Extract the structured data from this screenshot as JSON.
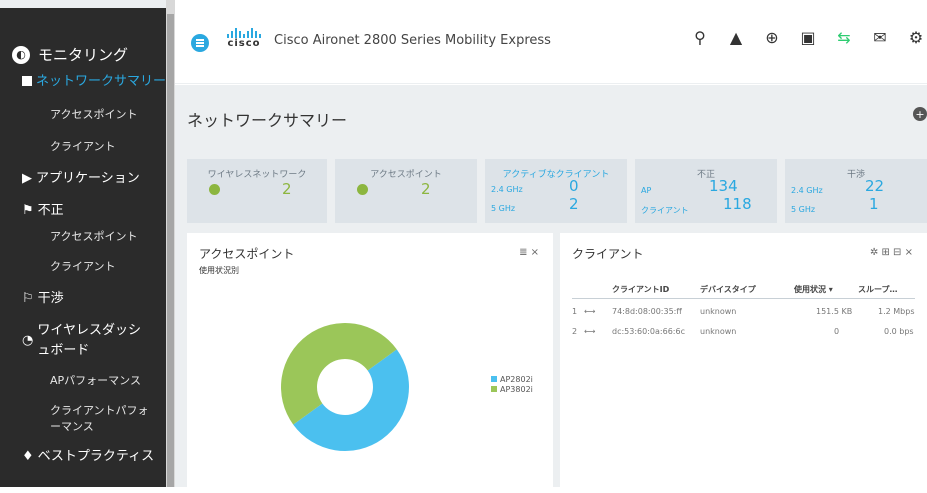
{
  "sidebar": {
    "heading": "モニタリング",
    "active_item": "ネットワークサマリー",
    "items": [
      {
        "type": "sub",
        "label": "アクセスポイント"
      },
      {
        "type": "sub",
        "label": "クライアント"
      },
      {
        "type": "section",
        "icon": "play-circle-icon",
        "label": "アプリケーション"
      },
      {
        "type": "section",
        "icon": "flag-icon",
        "label": "不正"
      },
      {
        "type": "sub",
        "label": "アクセスポイント"
      },
      {
        "type": "sub",
        "label": "クライアント"
      },
      {
        "type": "section",
        "icon": "flag-outline-icon",
        "label": "干渉"
      },
      {
        "type": "section",
        "icon": "dashboard-icon",
        "label": "ワイヤレスダッシュボード"
      },
      {
        "type": "sub",
        "label": "APパフォーマンス"
      },
      {
        "type": "sub",
        "label": "クライアントパフォーマンス"
      },
      {
        "type": "section",
        "icon": "trophy-icon",
        "label": "ベストプラクティス"
      }
    ]
  },
  "topbar": {
    "logo_text": "cisco",
    "title": "Cisco Aironet 2800 Series Mobility Express",
    "icons": [
      "search-icon",
      "alert-icon",
      "download-icon",
      "save-icon",
      "transfer-icon",
      "mail-icon",
      "gear-icon"
    ]
  },
  "page": {
    "title": "ネットワークサマリー"
  },
  "tiles": [
    {
      "title": "ワイヤレスネットワーク",
      "value": "2"
    },
    {
      "title": "アクセスポイント",
      "value": "2"
    },
    {
      "title": "アクティブなクライアント",
      "rows": [
        {
          "label": "2.4 GHz",
          "value": "0"
        },
        {
          "label": "5 GHz",
          "value": "2"
        }
      ]
    },
    {
      "title": "不正",
      "rows": [
        {
          "label": "AP",
          "value": "134"
        },
        {
          "label": "クライアント",
          "value": "118"
        }
      ]
    },
    {
      "title": "干渉",
      "rows": [
        {
          "label": "2.4 GHz",
          "value": "22"
        },
        {
          "label": "5 GHz",
          "value": "1"
        }
      ]
    }
  ],
  "ap_panel": {
    "title": "アクセスポイント",
    "subtitle": "使用状況別",
    "tools": "≣ ×"
  },
  "chart_data": {
    "type": "pie",
    "labels": [
      "AP2802i",
      "AP3802i"
    ],
    "values": [
      50,
      50
    ],
    "colors": [
      "#4bc0ef",
      "#9bc659"
    ],
    "donut": true,
    "legend_position": "right"
  },
  "client_panel": {
    "title": "クライアント",
    "tools": "✲ ⊞ ⊟ ×",
    "columns": [
      "クライアントID",
      "デバイスタイプ",
      "使用状況 ▾",
      "スループ…"
    ],
    "rows": [
      {
        "num": "1",
        "id": "74:8d:08:00:35:ff",
        "device": "unknown",
        "usage": "151.5 KB",
        "throughput": "1.2 Mbps"
      },
      {
        "num": "2",
        "id": "dc:53:60:0a:66:6c",
        "device": "unknown",
        "usage": "0",
        "throughput": "0.0 bps"
      }
    ]
  }
}
